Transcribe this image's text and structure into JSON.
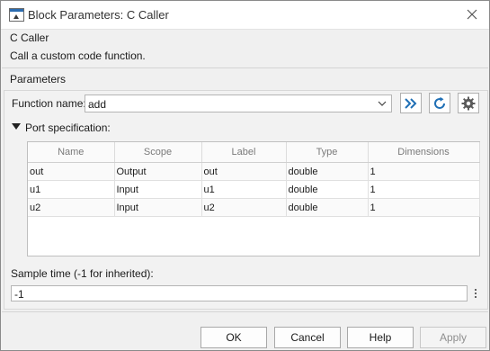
{
  "window": {
    "title": "Block Parameters: C Caller"
  },
  "block": {
    "name": "C Caller",
    "description": "Call a custom code function."
  },
  "parameters": {
    "heading": "Parameters",
    "function_name_label": "Function name:",
    "function_name_value": "add",
    "port_spec_label": "Port specification:",
    "columns": [
      "Name",
      "Scope",
      "Label",
      "Type",
      "Dimensions"
    ],
    "rows": [
      [
        "out",
        "Output",
        "out",
        "double",
        "1"
      ],
      [
        "u1",
        "Input",
        "u1",
        "double",
        "1"
      ],
      [
        "u2",
        "Input",
        "u2",
        "double",
        "1"
      ]
    ],
    "sample_time_label": "Sample time (-1 for inherited):",
    "sample_time_value": "-1"
  },
  "buttons": {
    "ok": "OK",
    "cancel": "Cancel",
    "help": "Help",
    "apply": "Apply"
  },
  "icons": {
    "app": "block-icon",
    "close": "close-icon",
    "goto": "double-chevron-right-icon",
    "refresh": "refresh-icon",
    "settings": "gear-icon",
    "dropdown": "chevron-down-icon",
    "expand": "triangle-down-icon",
    "more": "kebab-menu-icon"
  },
  "colors": {
    "accent_blue": "#1f6fb5"
  }
}
